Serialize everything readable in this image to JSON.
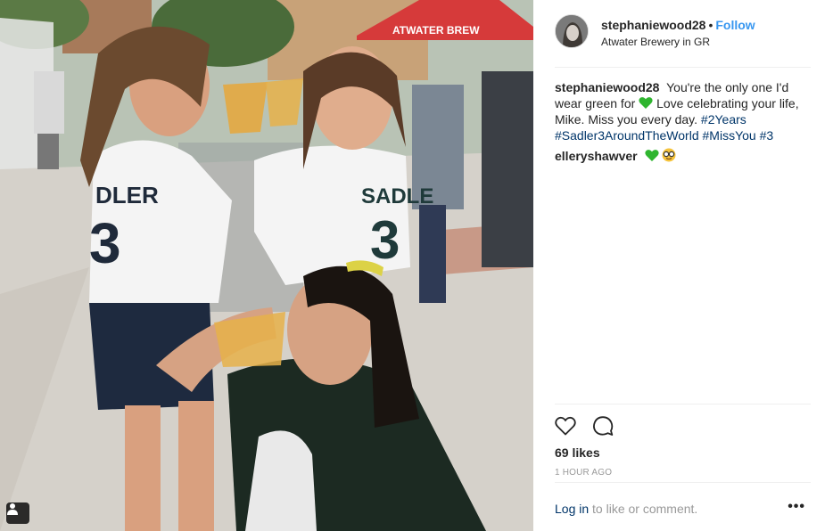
{
  "post": {
    "username": "stephaniewood28",
    "separator": "•",
    "follow_label": "Follow",
    "location": "Atwater Brewery in GR",
    "caption": {
      "username": "stephaniewood28",
      "text_before_heart": "You're the only one I'd wear green for",
      "text_after_heart": "Love celebrating your life, Mike. Miss you every day.",
      "hashtags": [
        "#2Years",
        "#Sadler3AroundTheWorld",
        "#MissYou",
        "#3"
      ]
    },
    "comments": [
      {
        "username": "elleryshawver"
      }
    ],
    "likes": "69 likes",
    "timestamp": "1 HOUR AGO",
    "login_link": "Log in",
    "login_rest": "to like or comment.",
    "more_label": "•••"
  },
  "photo": {
    "tent_text": "ATWATER BREW",
    "jersey_left_name": "DLER",
    "jersey_left_number": "3",
    "jersey_right_name": "SADLE",
    "jersey_right_number": "3"
  },
  "colors": {
    "link_blue": "#3897f0",
    "hashtag_blue": "#003569",
    "heart_green": "#2fb52f",
    "muted_gray": "#999999"
  },
  "icons": [
    "user-tag-icon",
    "heart-icon",
    "comment-icon",
    "green-heart-emoji",
    "nerd-face-emoji"
  ]
}
